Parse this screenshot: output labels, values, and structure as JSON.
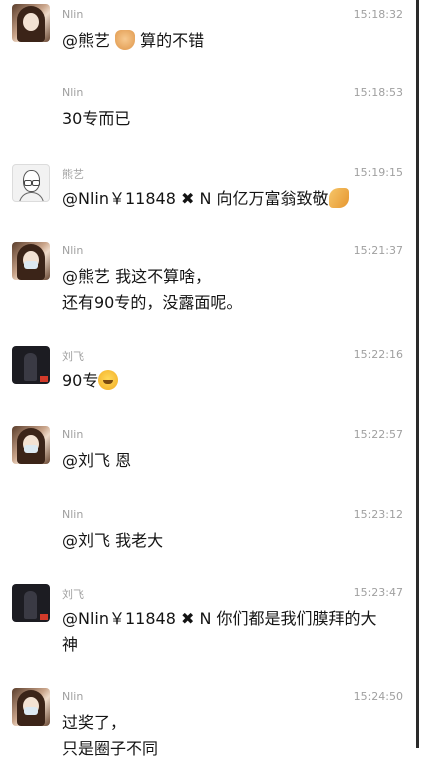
{
  "messages": [
    {
      "sender": "Nlin",
      "avatar": "avatar-nlin",
      "time": "15:18:32",
      "parts": [
        "@熊艺 ",
        "thumbs-up-emoji",
        " 算的不错"
      ]
    },
    {
      "sender": "Nlin",
      "avatar": "",
      "time": "15:18:53",
      "text": "30专而已"
    },
    {
      "sender": "熊艺",
      "avatar": "avatar-xiongyi",
      "time": "15:19:15",
      "parts": [
        "@Nlin￥11848",
        "✖",
        "N 向亿万富翁致敬",
        "clap-emoji"
      ]
    },
    {
      "sender": "Nlin",
      "avatar": "avatar-nlin",
      "time": "15:21:37",
      "text": "@熊艺 我这不算啥，\n还有90专的，没露面呢。"
    },
    {
      "sender": "刘飞",
      "avatar": "avatar-liufei",
      "time": "15:22:16",
      "parts": [
        "90专",
        "laugh-cry-emoji"
      ]
    },
    {
      "sender": "Nlin",
      "avatar": "avatar-nlin",
      "time": "15:22:57",
      "text": "@刘飞 恩"
    },
    {
      "sender": "Nlin",
      "avatar": "",
      "time": "15:23:12",
      "text": "@刘飞 我老大"
    },
    {
      "sender": "刘飞",
      "avatar": "avatar-liufei",
      "time": "15:23:47",
      "parts": [
        "@Nlin￥11848",
        "✖",
        "N 你们都是我们膜拜的大\n神"
      ]
    },
    {
      "sender": "Nlin",
      "avatar": "avatar-nlin",
      "time": "15:24:50",
      "text": "过奖了，\n只是圈子不同"
    }
  ]
}
